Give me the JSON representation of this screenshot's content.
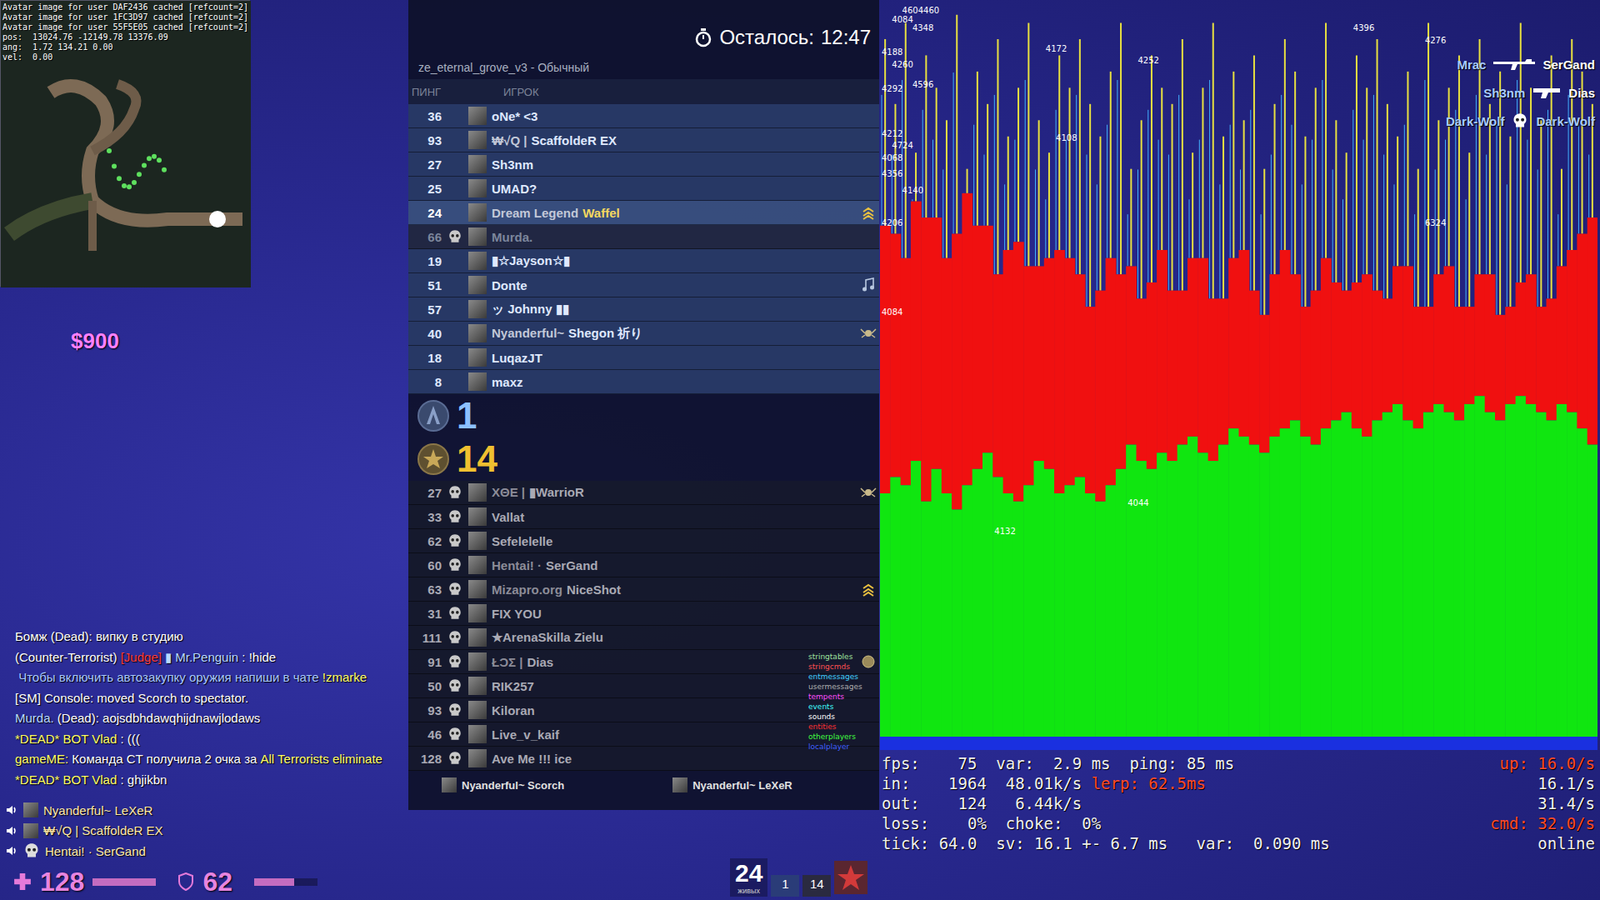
{
  "debug_overlay": {
    "lines": [
      "Avatar image for user DAF2436 cached [refcount=2]",
      "Avatar image for user 1FC3D97 cached [refcount=2]",
      "Avatar image for user 55F5E05 cached [refcount=2]",
      "pos:  13024.76 -12149.78 13376.09",
      "ang:  1.72 134.21 0.00",
      "vel:  0.00"
    ]
  },
  "hud": {
    "money": "$900",
    "health": {
      "value": "128",
      "level": 1.0
    },
    "armor": {
      "value": "62",
      "level": 0.62
    },
    "alive": {
      "value": "24",
      "label": "живых"
    },
    "score_ct": "1",
    "score_t": "14"
  },
  "scoreboard": {
    "title": "ze_eternal_grove_v3 - Обычный",
    "timer": {
      "label": "Осталось:",
      "value": "12:47"
    },
    "columns": [
      "ПИНГ",
      "ИГРОК"
    ],
    "teams": [
      {
        "team": "ct",
        "score": "1",
        "players": [
          {
            "ping": "36",
            "tag": "",
            "name": "oNe* <3",
            "dead": false,
            "local": false,
            "badge": "none"
          },
          {
            "ping": "93",
            "tag": "₩√Q |",
            "name": "ScaffoldeR EX",
            "dead": false,
            "local": false,
            "badge": "none"
          },
          {
            "ping": "27",
            "tag": "",
            "name": "Sh3nm",
            "dead": false,
            "local": false,
            "badge": "none"
          },
          {
            "ping": "25",
            "tag": "",
            "name": "UMAD?",
            "dead": false,
            "local": false,
            "badge": "none"
          },
          {
            "ping": "24",
            "tag": "Dream Legend",
            "name": "Waffel",
            "dead": false,
            "local": true,
            "badge": "chevron"
          },
          {
            "ping": "66",
            "tag": "",
            "name": "Murda.",
            "dead": true,
            "local": false,
            "badge": "none"
          },
          {
            "ping": "19",
            "tag": "",
            "name": "▮☆Jayson☆▮",
            "dead": false,
            "local": false,
            "badge": "none"
          },
          {
            "ping": "51",
            "tag": "",
            "name": "Donte",
            "dead": false,
            "local": false,
            "badge": "music"
          },
          {
            "ping": "57",
            "tag": "",
            "name": "ッ Johnny ▮▮",
            "dead": false,
            "local": false,
            "badge": "none"
          },
          {
            "ping": "40",
            "tag": "Nyanderful~",
            "name": "Shegon 祈り",
            "dead": false,
            "local": false,
            "badge": "emblem"
          },
          {
            "ping": "18",
            "tag": "",
            "name": "LuqazJT",
            "dead": false,
            "local": false,
            "badge": "none"
          },
          {
            "ping": "8",
            "tag": "",
            "name": "maxz",
            "dead": false,
            "local": false,
            "badge": "none"
          }
        ]
      },
      {
        "team": "t",
        "score": "14",
        "players": [
          {
            "ping": "27",
            "tag": "XΘE |",
            "name": "▮WarrioR",
            "dead": true,
            "local": false,
            "badge": "emblem"
          },
          {
            "ping": "33",
            "tag": "",
            "name": "Vallat",
            "dead": true,
            "local": false,
            "badge": "none"
          },
          {
            "ping": "62",
            "tag": "",
            "name": "Sefelelelle",
            "dead": true,
            "local": false,
            "badge": "none"
          },
          {
            "ping": "60",
            "tag": "Hentai! ·",
            "name": "SerGand",
            "dead": true,
            "local": false,
            "badge": "none"
          },
          {
            "ping": "63",
            "tag": "Mizapro.org",
            "name": "NiceShot",
            "dead": true,
            "local": false,
            "badge": "chevron"
          },
          {
            "ping": "31",
            "tag": "",
            "name": "FIX YOU",
            "dead": true,
            "local": false,
            "badge": "none"
          },
          {
            "ping": "111",
            "tag": "",
            "name": "★ArenaSkilla Zielu",
            "dead": true,
            "local": false,
            "badge": "none"
          },
          {
            "ping": "91",
            "tag": "ŁƆΣ |",
            "name": "Dias",
            "dead": true,
            "local": false,
            "badge": "coin"
          },
          {
            "ping": "50",
            "tag": "",
            "name": "RIK257",
            "dead": true,
            "local": false,
            "badge": "none"
          },
          {
            "ping": "93",
            "tag": "",
            "name": "Kiloran",
            "dead": true,
            "local": false,
            "badge": "none"
          },
          {
            "ping": "46",
            "tag": "",
            "name": "Live_v_kaif",
            "dead": true,
            "local": false,
            "badge": "none"
          },
          {
            "ping": "128",
            "tag": "",
            "name": "Ave Me !!! ice",
            "dead": true,
            "local": false,
            "badge": "none"
          }
        ]
      }
    ],
    "spectators": [
      "Nyanderful~ Scorch",
      "Nyanderful~ LeXeR"
    ]
  },
  "killfeed": [
    {
      "attacker": "Mrac",
      "attacker_color": "#a8ccff",
      "weapon": "rifle",
      "victim": "SerGand",
      "victim_color": "#ffffff"
    },
    {
      "attacker": "Sh3nm",
      "attacker_color": "#a8ccff",
      "weapon": "pistol",
      "victim": "Dias",
      "victim_color": "#ffffff"
    },
    {
      "attacker": "Dark-Wolf",
      "attacker_color": "#a8ccff",
      "weapon": "skull",
      "victim": "Dark-Wolf",
      "victim_color": "#a8ccff"
    }
  ],
  "chat": [
    [
      {
        "text": "Бомж (Dead)",
        "color": "#ffffff"
      },
      {
        "text": ": випку в студию",
        "color": "#ffffff"
      }
    ],
    [
      {
        "text": "(Counter-Terrorist) ",
        "color": "#ffffff"
      },
      {
        "text": "[Judge]",
        "color": "#ff3a3a"
      },
      {
        "text": " ▮ Mr.Penguin",
        "color": "#b8d8ff"
      },
      {
        "text": " : !hide",
        "color": "#ffffff"
      }
    ],
    [
      {
        "text": " Чтобы включить автозакупку оружия напиши в чате ",
        "color": "#a8c8ff"
      },
      {
        "text": "!zmarke",
        "color": "#ffff66"
      }
    ],
    [
      {
        "text": "[SM] Console: moved Scorch to spectator.",
        "color": "#ffffff"
      }
    ],
    [
      {
        "text": "Murda.",
        "color": "#b8d8ff"
      },
      {
        "text": " (Dead): aojsdbhdawqhijdnawjlodaws",
        "color": "#ffffff"
      }
    ],
    [
      {
        "text": "*DEAD* BOT Vlad",
        "color": "#ffff66"
      },
      {
        "text": " : (((",
        "color": "#ffffff"
      }
    ],
    [
      {
        "text": "gameME:",
        "color": "#ffff66"
      },
      {
        "text": " Команда CT получила 2 очка за ",
        "color": "#ffffff"
      },
      {
        "text": "All Terrorists eliminate",
        "color": "#ffff66"
      }
    ],
    [
      {
        "text": "*DEAD* BOT Vlad",
        "color": "#ffff66"
      },
      {
        "text": " : ghjikbn",
        "color": "#ffffff"
      }
    ]
  ],
  "voice": [
    {
      "name": "Nyanderful~ LeXeR",
      "dead": false
    },
    {
      "name": "₩√Q | ScaffoldeR EX",
      "dead": false
    },
    {
      "name": "Hentai! · SerGand",
      "dead": true
    }
  ],
  "net_graph": {
    "legend": [
      {
        "text": "stringtables",
        "color": "#9ee39e"
      },
      {
        "text": "stringcmds",
        "color": "#ff5050"
      },
      {
        "text": "entmessages",
        "color": "#40d0ff"
      },
      {
        "text": "usermessages",
        "color": "#b0b0b0"
      },
      {
        "text": "tempents",
        "color": "#ff50ff"
      },
      {
        "text": "events",
        "color": "#40ffff"
      },
      {
        "text": "sounds",
        "color": "#ffffff"
      },
      {
        "text": "entities",
        "color": "#ff3030"
      },
      {
        "text": "otherplayers",
        "color": "#40ff40"
      },
      {
        "text": "localplayer",
        "color": "#4060ff"
      }
    ],
    "chart": {
      "green": [
        300,
        320,
        310,
        340,
        290,
        330,
        300,
        280,
        310,
        330,
        350,
        320,
        300,
        290,
        310,
        340,
        330,
        300,
        310,
        320,
        300,
        290,
        310,
        330,
        360,
        340,
        330,
        350,
        340,
        360,
        370,
        350,
        340,
        360,
        380,
        370,
        360,
        350,
        370,
        380,
        390,
        370,
        360,
        380,
        390,
        400,
        380,
        370,
        390,
        400,
        410,
        390,
        380,
        400,
        410,
        400,
        390,
        410,
        420,
        400,
        390,
        410,
        420,
        410,
        400,
        390,
        410,
        400,
        380,
        360
      ],
      "red": [
        330,
        300,
        280,
        320,
        350,
        310,
        290,
        340,
        360,
        300,
        280,
        250,
        300,
        320,
        270,
        240,
        260,
        300,
        280,
        250,
        230,
        260,
        280,
        240,
        220,
        200,
        230,
        250,
        210,
        190,
        220,
        240,
        200,
        180,
        210,
        230,
        190,
        170,
        200,
        220,
        180,
        160,
        190,
        210,
        170,
        150,
        180,
        200,
        160,
        140,
        170,
        190,
        150,
        130,
        160,
        180,
        140,
        120,
        150,
        170,
        130,
        120,
        140,
        160,
        130,
        150,
        170,
        200,
        240,
        280
      ],
      "spikes": [
        860,
        780,
        880,
        720,
        840,
        800,
        760,
        890,
        700,
        820,
        780,
        860,
        740,
        800,
        880,
        760,
        720,
        840,
        800,
        860,
        780,
        740,
        820,
        880,
        700,
        760,
        840,
        800,
        780,
        860,
        720,
        800,
        880,
        740,
        820,
        760,
        840,
        700,
        780,
        860,
        820,
        740,
        800,
        880,
        760,
        720,
        840,
        800,
        860,
        780,
        740,
        820,
        700,
        880,
        760,
        800,
        840,
        720,
        860,
        780,
        820,
        740,
        880,
        800,
        760,
        840,
        700,
        860,
        820,
        780
      ],
      "annotations": [
        {
          "bar": 1,
          "value": 880,
          "text": "4084"
        },
        {
          "bar": 3,
          "value": 870,
          "text": "4348"
        },
        {
          "bar": 2,
          "value": 892,
          "text": "4604460"
        },
        {
          "bar": 0,
          "value": 840,
          "text": "4188"
        },
        {
          "bar": 1,
          "value": 825,
          "text": "4260"
        },
        {
          "bar": 3,
          "value": 800,
          "text": "4596"
        },
        {
          "bar": 0,
          "value": 795,
          "text": "4292"
        },
        {
          "bar": 0,
          "value": 740,
          "text": "4212"
        },
        {
          "bar": 1,
          "value": 725,
          "text": "4724"
        },
        {
          "bar": 0,
          "value": 710,
          "text": "4068"
        },
        {
          "bar": 0,
          "value": 690,
          "text": "4356"
        },
        {
          "bar": 2,
          "value": 670,
          "text": "4140"
        },
        {
          "bar": 0,
          "value": 630,
          "text": "4206"
        },
        {
          "bar": 0,
          "value": 520,
          "text": "4084"
        },
        {
          "bar": 16,
          "value": 845,
          "text": "4172"
        },
        {
          "bar": 17,
          "value": 735,
          "text": "4108"
        },
        {
          "bar": 25,
          "value": 830,
          "text": "4252"
        },
        {
          "bar": 46,
          "value": 870,
          "text": "4396"
        },
        {
          "bar": 53,
          "value": 855,
          "text": "4276"
        },
        {
          "bar": 53,
          "value": 630,
          "text": "6324"
        },
        {
          "bar": 24,
          "value": 285,
          "text": "4044"
        },
        {
          "bar": 11,
          "value": 250,
          "text": "4132"
        }
      ]
    },
    "stats": [
      [
        {
          "text": "fps:    75  var:  2.9 ms  ping: 85 ms",
          "warn": false
        }
      ],
      [
        {
          "text": "in:    1964  48.01k/s ",
          "warn": false
        },
        {
          "text": "lerp: 62.5ms",
          "warn": true
        }
      ],
      [
        {
          "text": "out:    124   6.44k/s",
          "warn": false
        }
      ],
      [
        {
          "text": "loss:    0%  choke:  0%",
          "warn": false
        }
      ],
      [
        {
          "text": "tick: 64.0  sv: 16.1 +- 6.7 ms   var:  0.090 ms",
          "warn": false
        }
      ]
    ],
    "rates": [
      {
        "text": "up: 16.0/s",
        "warn": true
      },
      {
        "text": "16.1/s",
        "warn": false
      },
      {
        "text": "31.4/s",
        "warn": false
      },
      {
        "text": "cmd: 32.0/s",
        "warn": true
      },
      {
        "text": "online",
        "warn": false
      }
    ]
  }
}
